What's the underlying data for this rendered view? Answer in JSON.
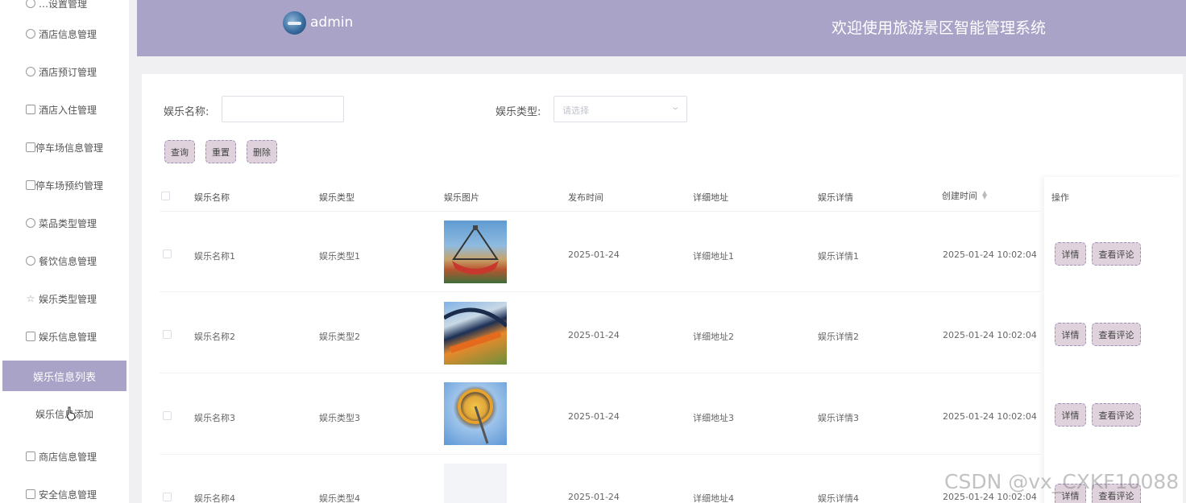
{
  "sidebar": {
    "top_clipped": "…设置管理",
    "items": [
      {
        "label": "酒店信息管理"
      },
      {
        "label": "酒店预订管理"
      },
      {
        "label": "酒店入住管理"
      },
      {
        "label": "停车场信息管理"
      },
      {
        "label": "停车场预约管理"
      },
      {
        "label": "菜品类型管理"
      },
      {
        "label": "餐饮信息管理"
      },
      {
        "label": "娱乐类型管理"
      },
      {
        "label": "娱乐信息管理"
      }
    ],
    "sub_items": [
      {
        "label": "娱乐信息列表",
        "active": true
      },
      {
        "label": "娱乐信息添加",
        "active": false
      }
    ],
    "bottom_items": [
      {
        "label": "商店信息管理"
      },
      {
        "label": "安全信息管理"
      }
    ]
  },
  "header": {
    "username": "admin",
    "title": "欢迎使用旅游景区智能管理系统"
  },
  "search": {
    "name_label": "娱乐名称:",
    "name_value": "",
    "type_label": "娱乐类型:",
    "type_placeholder": "请选择",
    "query_button": "查询",
    "reset_button": "重置",
    "delete_button": "删除"
  },
  "table": {
    "headers": [
      "娱乐名称",
      "娱乐类型",
      "娱乐图片",
      "发布时间",
      "详细地址",
      "娱乐详情",
      "创建时间",
      "操作"
    ],
    "rows": [
      {
        "name": "娱乐名称1",
        "type": "娱乐类型1",
        "publish": "2025-01-24",
        "address": "详细地址1",
        "detail": "娱乐详情1",
        "created": "2025-01-24 10:02:04"
      },
      {
        "name": "娱乐名称2",
        "type": "娱乐类型2",
        "publish": "2025-01-24",
        "address": "详细地址2",
        "detail": "娱乐详情2",
        "created": "2025-01-24 10:02:04"
      },
      {
        "name": "娱乐名称3",
        "type": "娱乐类型3",
        "publish": "2025-01-24",
        "address": "详细地址3",
        "detail": "娱乐详情3",
        "created": "2025-01-24 10:02:04"
      },
      {
        "name": "娱乐名称4",
        "type": "娱乐类型4",
        "publish": "2025-01-24",
        "address": "详细地址4",
        "detail": "娱乐详情4",
        "created": "2025-01-24 10:02:04"
      }
    ],
    "detail_button": "详情",
    "comment_button": "查看评论"
  },
  "watermark": "CSDN @vx_CXKF10088",
  "colors": {
    "accent": "#a9a3c8",
    "button_bg": "#dfd2dc",
    "button_border": "#9d8fb8"
  }
}
